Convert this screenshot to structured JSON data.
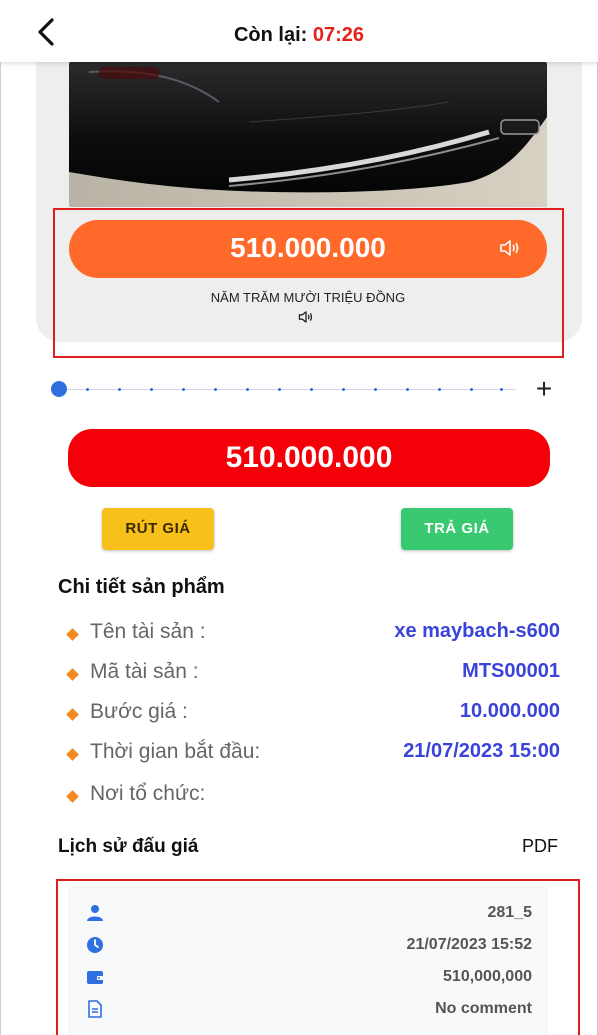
{
  "header": {
    "title_label": "Còn lại:",
    "time_left": "07:26"
  },
  "product": {
    "current_price": "510.000.000",
    "price_in_words": "NĂM TRĂM MƯỜI TRIỆU ĐỒNG"
  },
  "bid": {
    "amount": "510.000.000",
    "withdraw_label": "RÚT GIÁ",
    "bid_label": "TRẢ GIÁ"
  },
  "details": {
    "title": "Chi tiết sản phẩm",
    "rows": [
      {
        "label": "Tên tài sản :",
        "value": "xe maybach-s600"
      },
      {
        "label": "Mã tài sản :",
        "value": "MTS00001"
      },
      {
        "label": "Bước giá :",
        "value": "10.000.000"
      },
      {
        "label": "Thời gian bắt đầu:",
        "value": "21/07/2023 15:00"
      },
      {
        "label": "Nơi tổ chức:",
        "value": ""
      }
    ]
  },
  "history": {
    "title": "Lịch sử đấu giá",
    "pdf_label": "PDF",
    "entry": {
      "user": "281_5",
      "time": "21/07/2023 15:52",
      "amount": "510,000,000",
      "comment": "No comment"
    }
  },
  "colors": {
    "accent_red": "#f30009",
    "orange": "#ff6a2a",
    "blue_value": "#3b44d9",
    "yellow_button": "#f7c01a",
    "green_button": "#38c971"
  }
}
